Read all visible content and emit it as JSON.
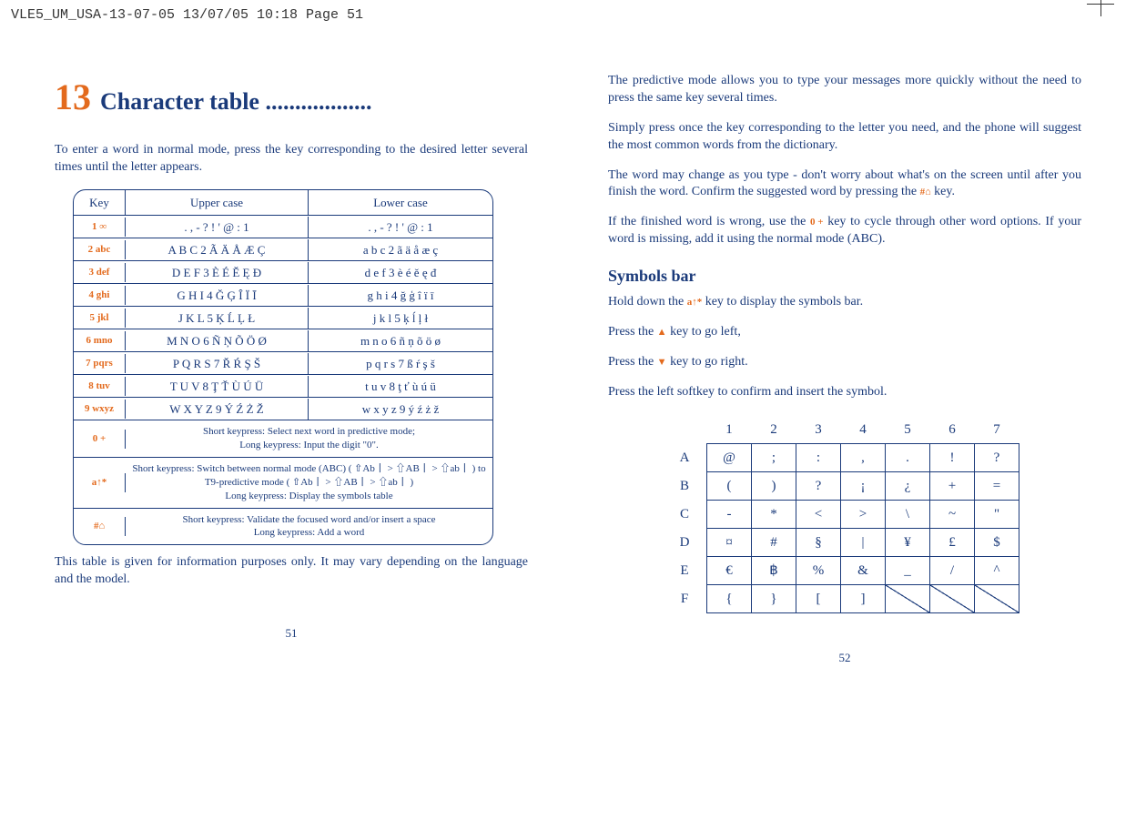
{
  "print_header": "VLE5_UM_USA-13-07-05  13/07/05  10:18  Page 51",
  "left": {
    "chapter_num": "13",
    "chapter_title": "Character table ..................",
    "intro": "To enter a word in normal mode, press the key corresponding to the desired letter several times until the letter appears.",
    "table": {
      "headers": {
        "key": "Key",
        "upper": "Upper case",
        "lower": "Lower case"
      },
      "rows": [
        {
          "key": "1 ∞",
          "upper": ". , - ? ! ' @ : 1",
          "lower": ". , - ? ! ' @ : 1"
        },
        {
          "key": "2 abc",
          "upper": "A B C 2 Ã Ä Å Æ Ç",
          "lower": "a b c 2 ã ä å æ ç"
        },
        {
          "key": "3 def",
          "upper": "D E F 3 È É Ě Ę Đ",
          "lower": "d e f 3 è é ě ę đ"
        },
        {
          "key": "4 ghi",
          "upper": "G H I 4 Ğ Ģ Î Ï Ī",
          "lower": "g h i 4 ğ ģ î ï ī"
        },
        {
          "key": "5 jkl",
          "upper": "J K L 5 Ķ Ĺ Ļ Ł",
          "lower": "j k l 5 ķ ĺ ļ ł"
        },
        {
          "key": "6 mno",
          "upper": "M N O 6 Ñ Ņ Õ Ö Ø",
          "lower": "m n o 6 ñ ņ õ ö ø"
        },
        {
          "key": "7 pqrs",
          "upper": "P Q R S 7 Ř Ŕ Ş Š",
          "lower": "p q r s 7 ß ŕ ş š"
        },
        {
          "key": "8 tuv",
          "upper": "T U V 8 Ţ Ť Ù Ú Ü",
          "lower": "t u v 8 ţ ť ù ú ü"
        },
        {
          "key": "9 wxyz",
          "upper": "W X Y Z 9 Ý Ź Ż Ž",
          "lower": "w x y z 9 ý ź ż ž"
        }
      ],
      "special": [
        {
          "key": "0 +",
          "text": "Short keypress: Select next word in predictive mode;\nLong keypress: Input the digit \"0\"."
        },
        {
          "key": "a↑*",
          "text": "Short keypress: Switch between normal mode (ABC) ( ⇧Ab丨 > ⇧AB丨 > ⇧ab丨 ) to\nT9-predictive mode ( ⇧Ab丨 > ⇧AB丨 > ⇧ab丨 )\nLong keypress: Display the symbols table"
        },
        {
          "key": "#⌂",
          "text": "Short keypress: Validate the focused word and/or insert a space\nLong keypress: Add a word"
        }
      ]
    },
    "footnote": "This table is given for information purposes only. It may vary depending on the language and the model.",
    "pagenum": "51"
  },
  "right": {
    "p1": "The predictive mode allows you to type your messages more quickly without the need to press the same key several times.",
    "p2": "Simply press once the key corresponding to the letter you need, and the phone will suggest the most common words from the dictionary.",
    "p3a": "The word may change as you type - don't worry about what's on the screen until after you finish the word. Confirm the suggested word by pressing the ",
    "p3_key": "#⌂",
    "p3b": " key.",
    "p4a": "If the finished word is wrong, use the ",
    "p4_key": "0 +",
    "p4b": " key to cycle through other word options. If your word is missing, add it using the normal mode (ABC).",
    "sub": "Symbols bar",
    "s1a": "Hold down the ",
    "s1_key": "a↑*",
    "s1b": " key to display the symbols bar.",
    "s2a": "Press the ",
    "s2b": " key to go left,",
    "s3a": "Press the ",
    "s3b": " key to go right.",
    "s4": "Press the left softkey to confirm and insert the symbol.",
    "grid": {
      "cols": [
        "1",
        "2",
        "3",
        "4",
        "5",
        "6",
        "7"
      ],
      "rows": [
        "A",
        "B",
        "C",
        "D",
        "E",
        "F"
      ],
      "cells": [
        [
          "@",
          ";",
          ":",
          ",",
          ".",
          "!",
          "?"
        ],
        [
          "(",
          ")",
          "?",
          "¡",
          "¿",
          "+",
          "="
        ],
        [
          "-",
          "*",
          "<",
          ">",
          "\\",
          "~",
          "\""
        ],
        [
          "¤",
          "#",
          "§",
          "|",
          "¥",
          "£",
          "$"
        ],
        [
          "€",
          "฿",
          "%",
          "&",
          "_",
          "/",
          "^"
        ],
        [
          "{",
          "}",
          "[",
          "]",
          "/",
          "/",
          "/"
        ]
      ],
      "diag_last_row_from": 4
    },
    "pagenum": "52"
  }
}
